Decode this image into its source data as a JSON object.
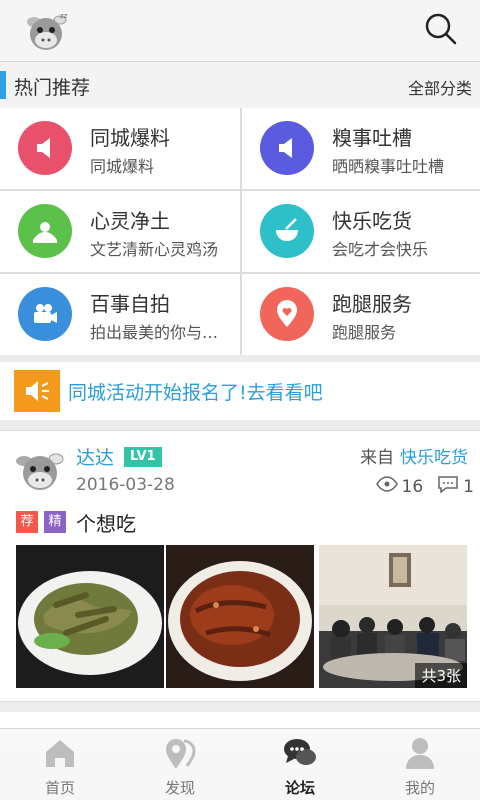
{
  "header": {
    "logo_icon": "cow-avatar-icon",
    "search_icon": "search-icon"
  },
  "section": {
    "title": "热门推荐",
    "all_label": "全部分类"
  },
  "categories": [
    {
      "title": "同城爆料",
      "subtitle": "同城爆料",
      "color": "#e8506c",
      "icon": "megaphone-icon"
    },
    {
      "title": "糗事吐槽",
      "subtitle": "晒晒糗事吐吐槽",
      "color": "#5b5be0",
      "icon": "megaphone-icon"
    },
    {
      "title": "心灵净土",
      "subtitle": "文艺清新心灵鸡汤",
      "color": "#5cc14a",
      "icon": "landscape-icon"
    },
    {
      "title": "快乐吃货",
      "subtitle": "会吃才会快乐",
      "color": "#2ec0c8",
      "icon": "bowl-icon"
    },
    {
      "title": "百事自拍",
      "subtitle": "拍出最美的你与…",
      "color": "#3a8fdc",
      "icon": "camera-icon"
    },
    {
      "title": "跑腿服务",
      "subtitle": "跑腿服务",
      "color": "#f0665a",
      "icon": "location-heart-icon"
    }
  ],
  "banner": {
    "text": "同城活动开始报名了!去看看吧",
    "icon": "speaker-icon",
    "color": "#f39a1c"
  },
  "post": {
    "username": "达达",
    "level": "LV1",
    "date": "2016-03-28",
    "from_label": "来自",
    "from_board": "快乐吃货",
    "views": "16",
    "comments": "1",
    "tag_recommend": "荐",
    "tag_featured": "精",
    "title": "个想吃",
    "image_count": "共3张"
  },
  "nav": [
    {
      "label": "首页",
      "icon": "home-icon",
      "active": false
    },
    {
      "label": "发现",
      "icon": "location-icon",
      "active": false
    },
    {
      "label": "论坛",
      "icon": "chat-bubbles-icon",
      "active": true
    },
    {
      "label": "我的",
      "icon": "person-icon",
      "active": false
    }
  ]
}
